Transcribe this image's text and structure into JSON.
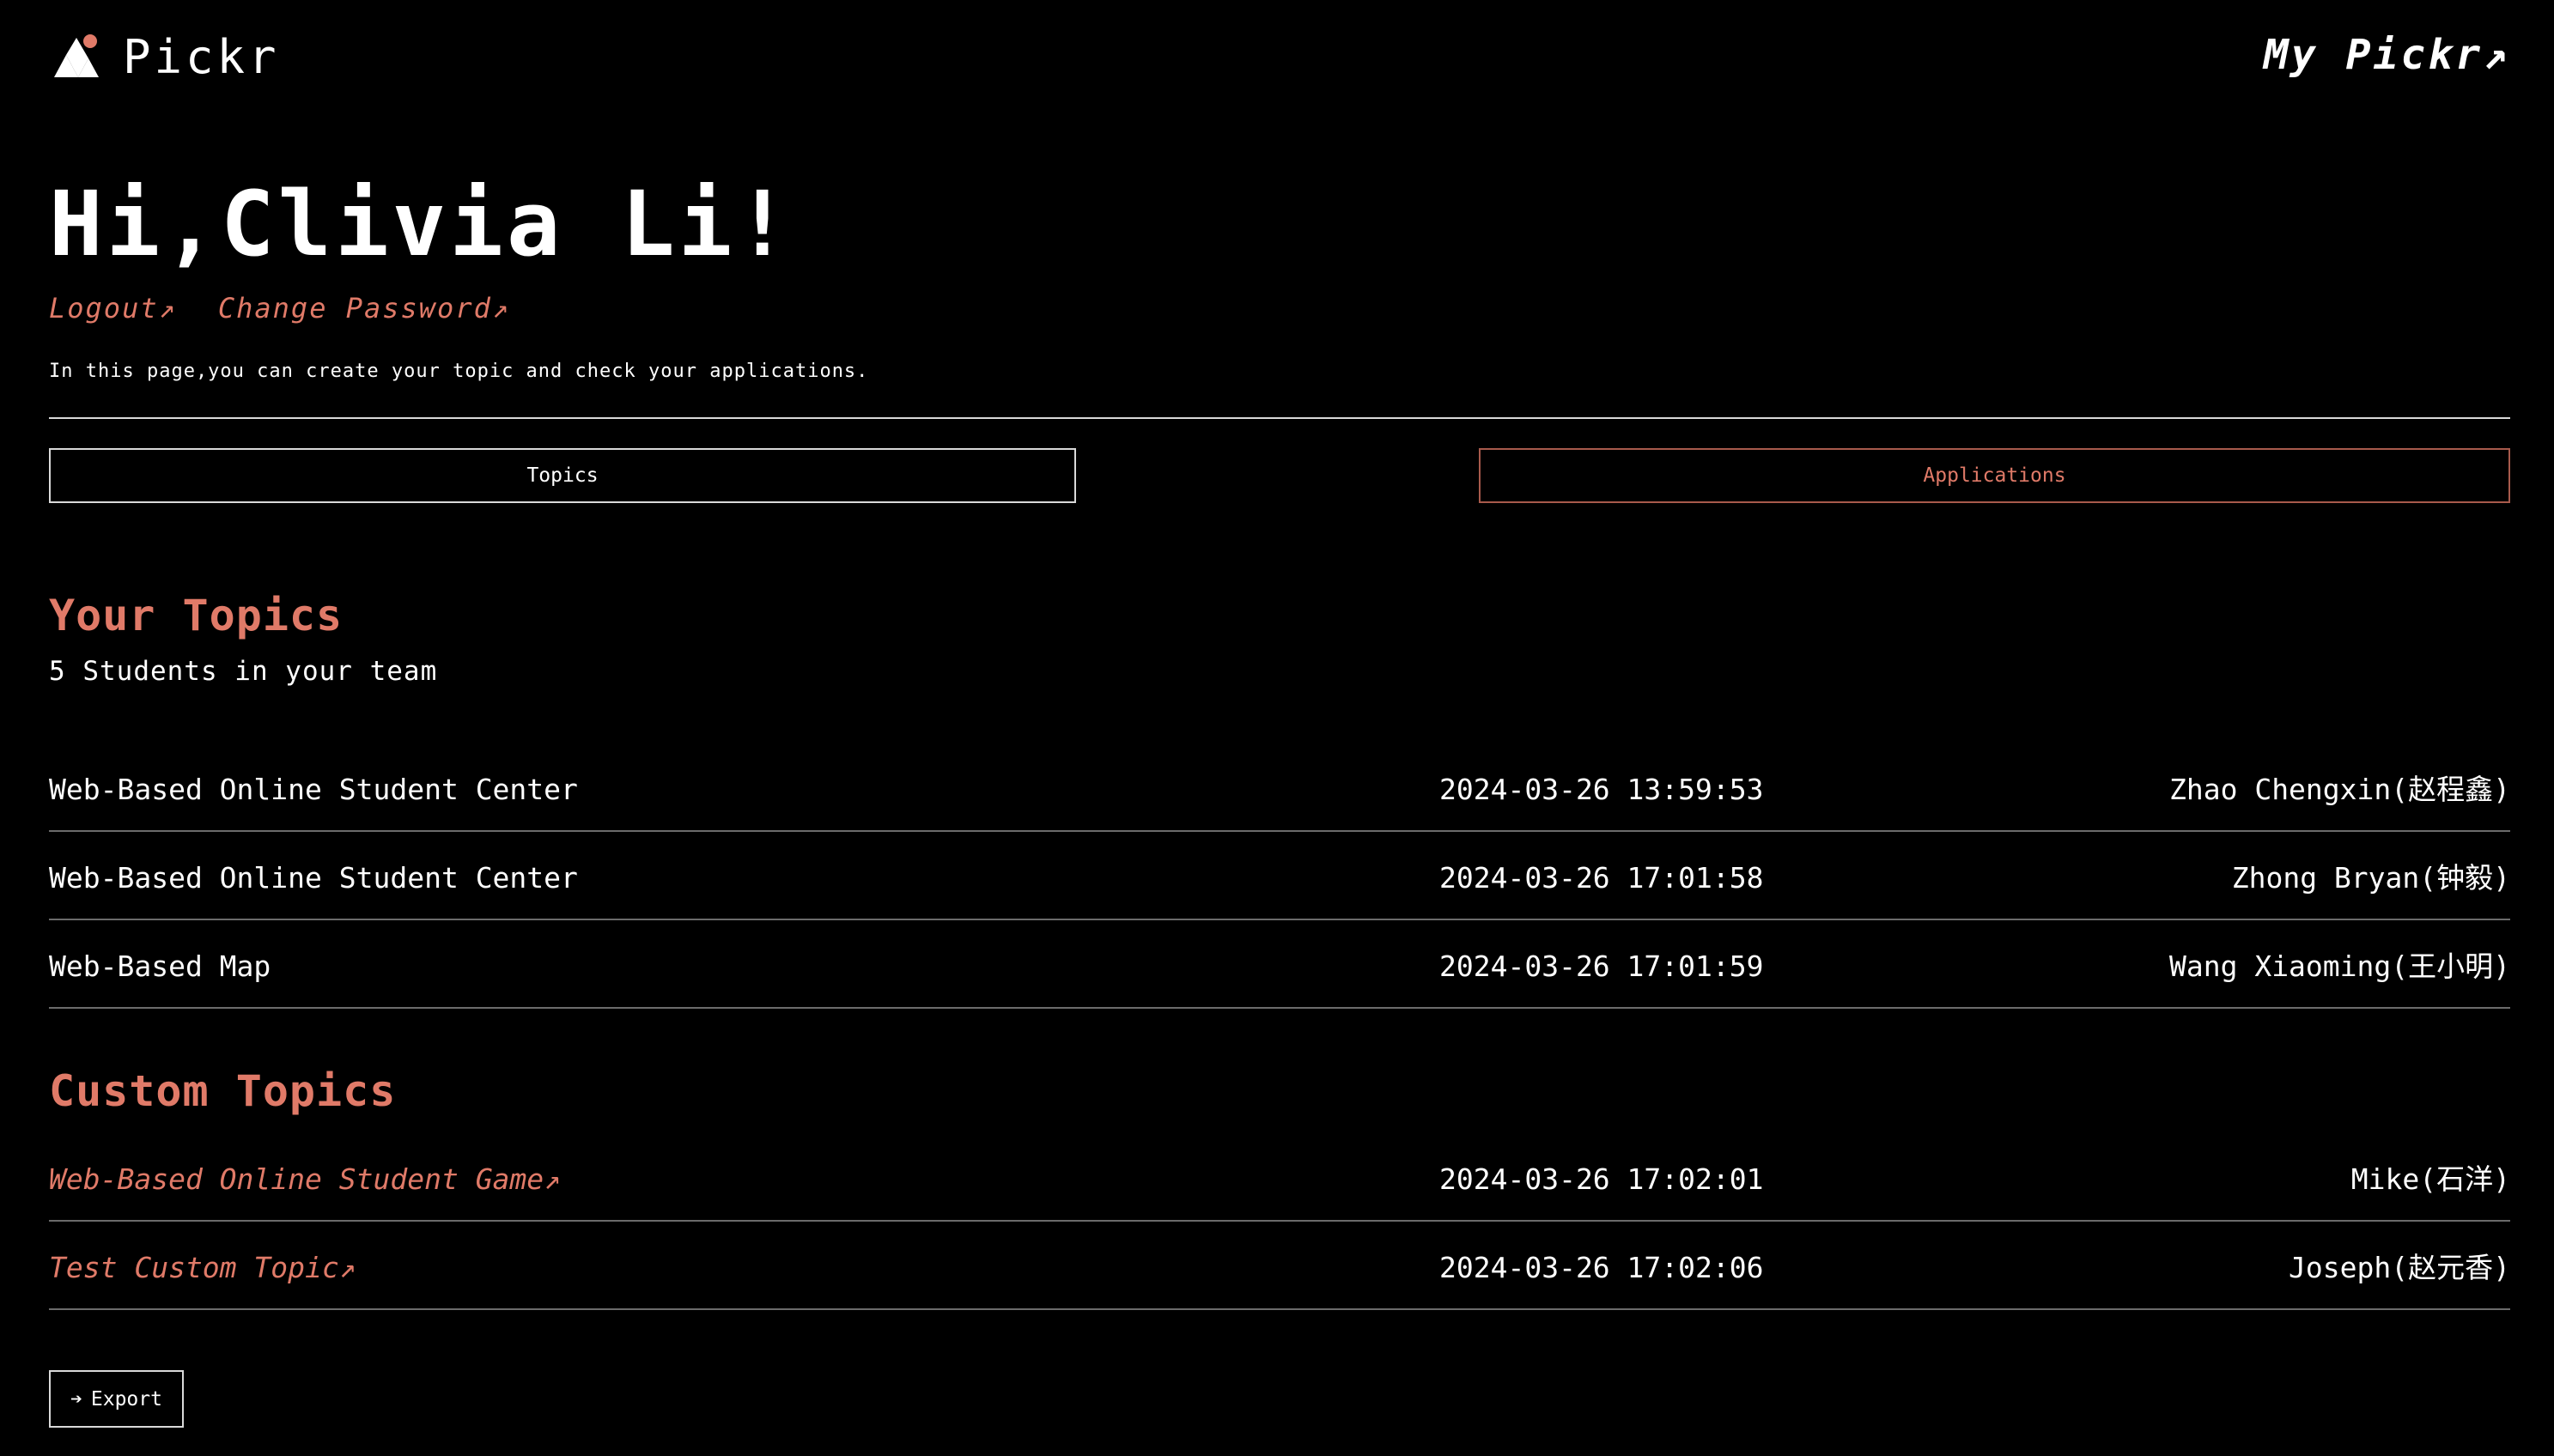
{
  "brand": {
    "name": "Pickr"
  },
  "header": {
    "my_link": "My Pickr↗"
  },
  "greeting": "Hi,Clivia Li!",
  "account_links": {
    "logout": "Logout↗",
    "change_password": "Change Password↗"
  },
  "intro": "In this page,you can create your topic and check your applications.",
  "tabs": {
    "topics": "Topics",
    "applications": "Applications"
  },
  "your_topics": {
    "title": "Your Topics",
    "subtitle": "5 Students in your team",
    "rows": [
      {
        "title": "Web-Based Online Student Center",
        "time": "2024-03-26 13:59:53",
        "owner": "Zhao Chengxin(赵程鑫)"
      },
      {
        "title": "Web-Based Online Student Center",
        "time": "2024-03-26 17:01:58",
        "owner": "Zhong Bryan(钟毅)"
      },
      {
        "title": "Web-Based Map",
        "time": "2024-03-26 17:01:59",
        "owner": "Wang Xiaoming(王小明)"
      }
    ]
  },
  "custom_topics": {
    "title": "Custom Topics",
    "rows": [
      {
        "title": "Web-Based Online Student Game↗",
        "time": "2024-03-26 17:02:01",
        "owner": "Mike(石洋)"
      },
      {
        "title": "Test Custom Topic↗",
        "time": "2024-03-26 17:02:06",
        "owner": "Joseph(赵元香)"
      }
    ]
  },
  "export": {
    "arrow": "➔",
    "label": "Export"
  },
  "colors": {
    "background": "#000000",
    "accent": "#e07a68",
    "text": "#ffffff",
    "divider": "#6b6b6b"
  }
}
